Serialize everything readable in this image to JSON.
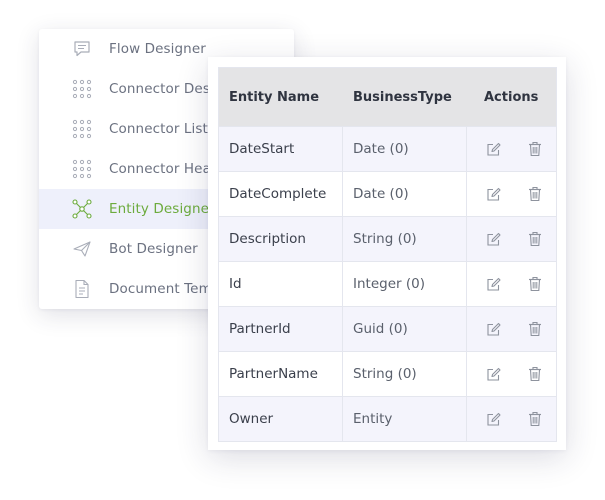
{
  "sidebar": {
    "items": [
      {
        "label": "Flow Designer",
        "icon": "chat-icon",
        "active": false
      },
      {
        "label": "Connector Designer",
        "icon": "dots-grid-icon",
        "active": false
      },
      {
        "label": "Connector List",
        "icon": "dots-grid-icon",
        "active": false
      },
      {
        "label": "Connector Health",
        "icon": "dots-grid-icon",
        "active": false
      },
      {
        "label": "Entity Designer",
        "icon": "network-icon",
        "active": true
      },
      {
        "label": "Bot Designer",
        "icon": "paper-plane-icon",
        "active": false
      },
      {
        "label": "Document Templates",
        "icon": "document-icon",
        "active": false
      }
    ]
  },
  "table": {
    "headers": {
      "name": "Entity Name",
      "type": "BusinessType",
      "actions": "Actions"
    },
    "rows": [
      {
        "name": "DateStart",
        "type": "Date (0)"
      },
      {
        "name": "DateComplete",
        "type": "Date (0)"
      },
      {
        "name": "Description",
        "type": "String (0)"
      },
      {
        "name": "Id",
        "type": "Integer (0)"
      },
      {
        "name": "PartnerId",
        "type": "Guid (0)"
      },
      {
        "name": "PartnerName",
        "type": "String (0)"
      },
      {
        "name": "Owner",
        "type": "Entity"
      }
    ]
  },
  "colors": {
    "active_text": "#6cab3d",
    "active_bg": "#eef0fb",
    "icon_gray": "#a9adb8"
  }
}
